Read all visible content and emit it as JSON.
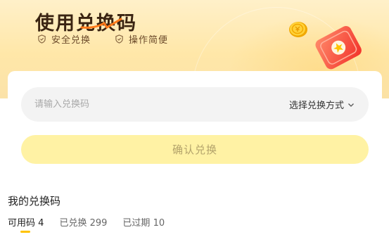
{
  "banner": {
    "title": "使用兑换码",
    "features": [
      "安全兑换",
      "操作简便"
    ]
  },
  "redeem": {
    "input_placeholder": "请输入兑换码",
    "input_value": "",
    "method_label": "选择兑换方式",
    "confirm_label": "确认兑换"
  },
  "my_codes": {
    "title": "我的兑换码",
    "tabs": [
      {
        "label": "可用码",
        "count": "4"
      },
      {
        "label": "已兑换",
        "count": "299"
      },
      {
        "label": "已过期",
        "count": "10"
      }
    ]
  },
  "colors": {
    "accent": "#ffc300",
    "button_bg": "#fff2a4",
    "title_text": "#3a2412"
  },
  "icons": [
    "shield-check-icon",
    "chevron-down-icon",
    "coin-icon",
    "red-ticket-icon"
  ]
}
